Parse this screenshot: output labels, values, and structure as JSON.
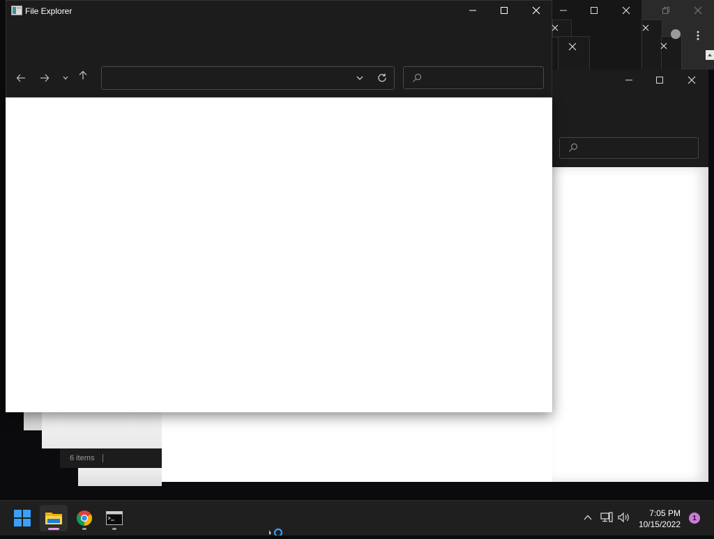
{
  "colors": {
    "desktop": "#0b0b0d",
    "titlebar": "#1c1c1c",
    "content": "#ffffff",
    "taskbar": "#1f1f1f",
    "accent_windows": "#3aa0ff",
    "notification_badge": "#c97bd8"
  },
  "main_window": {
    "title": "File Explorer",
    "icons": {
      "app": "file-explorer-app-icon",
      "minimize": "minimize-icon",
      "maximize": "maximize-icon",
      "close": "close-icon",
      "back": "arrow-left-icon",
      "forward": "arrow-right-icon",
      "recent": "chevron-down-icon",
      "up": "arrow-up-icon",
      "address_dropdown": "chevron-down-icon",
      "refresh": "refresh-icon",
      "search": "search-icon"
    },
    "address_value": "",
    "search_placeholder": ""
  },
  "background_window": {
    "search_placeholder": "",
    "status_items": "6 items"
  },
  "taskbar": {
    "apps": [
      {
        "name": "Start",
        "icon": "windows-start-icon"
      },
      {
        "name": "File Explorer",
        "icon": "folder-icon"
      },
      {
        "name": "Google Chrome",
        "icon": "chrome-icon"
      },
      {
        "name": "Command Prompt",
        "icon": "terminal-icon"
      }
    ],
    "tray": {
      "time": "7:05 PM",
      "date": "10/15/2022",
      "notification_count": "1",
      "icons": [
        "chevron-up-icon",
        "network-icon",
        "volume-icon"
      ]
    }
  }
}
